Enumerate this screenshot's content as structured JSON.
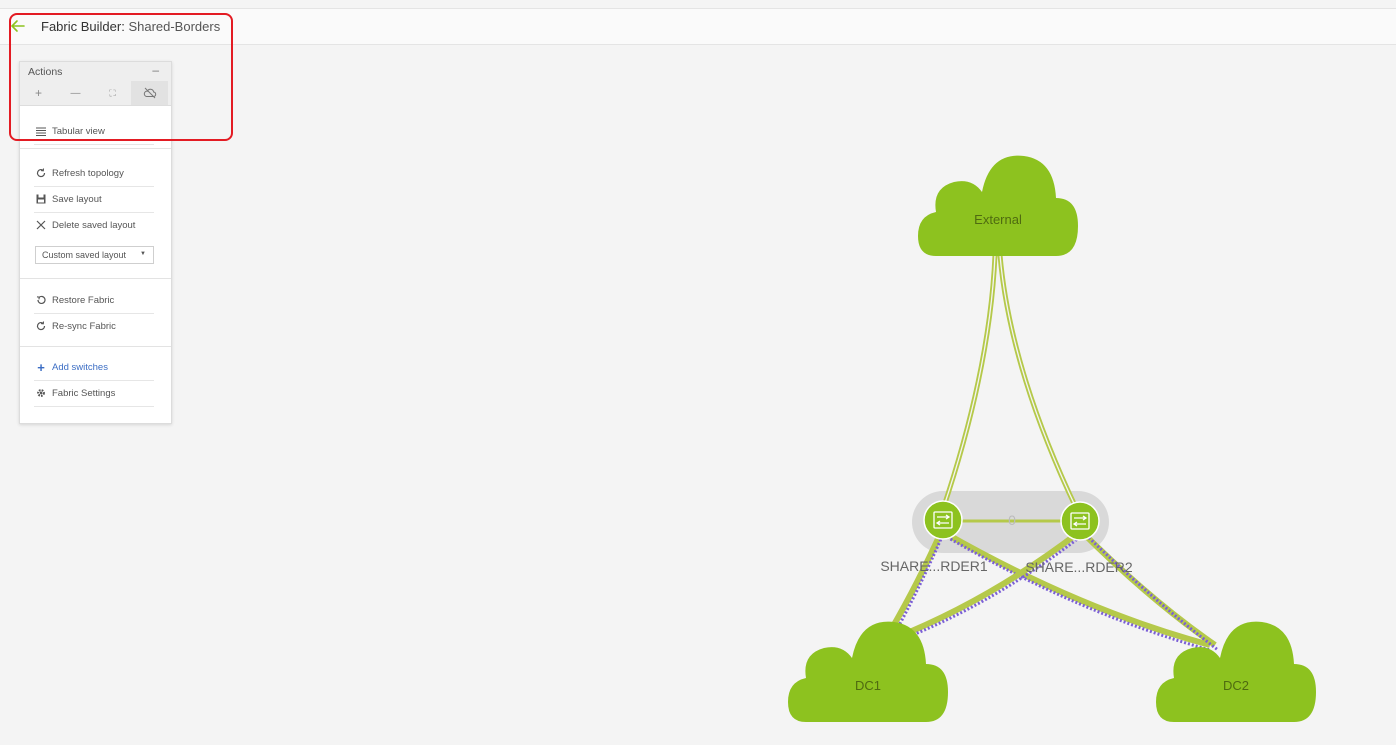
{
  "header": {
    "title_prefix": "Fabric Builder:",
    "title_name": "Shared-Borders"
  },
  "actions_panel": {
    "header_label": "Actions",
    "minimize_label": "–",
    "tools": [
      {
        "label": "+",
        "icon": "zoom-in-icon"
      },
      {
        "label": "—",
        "icon": "zoom-out-icon"
      },
      {
        "label": "⛶",
        "icon": "fit-screen-icon"
      },
      {
        "label": "",
        "icon": "cloud-off-icon"
      }
    ],
    "tabular_view": "Tabular view",
    "refresh_topology": "Refresh topology",
    "save_layout": "Save layout",
    "delete_saved_layout": "Delete saved layout",
    "layout_select_value": "Custom saved layout",
    "restore_fabric": "Restore Fabric",
    "resync_fabric": "Re-sync Fabric",
    "add_switches": "Add switches",
    "fabric_settings": "Fabric Settings"
  },
  "topology": {
    "clouds": [
      {
        "name": "External"
      },
      {
        "name": "DC1"
      },
      {
        "name": "DC2"
      }
    ],
    "switches": [
      {
        "name": "SHARE...RDER1"
      },
      {
        "name": "SHARE...RDER2"
      }
    ],
    "vpc_pair_label": "0",
    "colors": {
      "cloud": "#8dc21f",
      "link": "#b5c94a",
      "link_dashed": "#7b5fd6",
      "vpc_pill": "#d9d9d9",
      "highlight": "#e31b23",
      "back_arrow": "#8dc21f"
    }
  }
}
